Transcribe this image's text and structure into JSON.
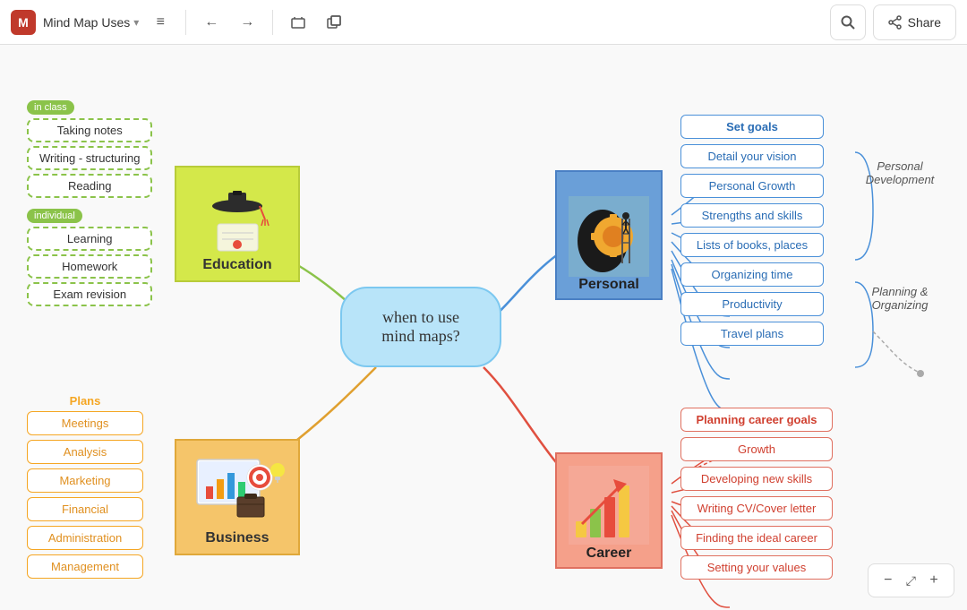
{
  "topbar": {
    "logo": "M",
    "title": "Mind Map Uses",
    "chevron": "▾",
    "menu_icon": "≡",
    "undo_label": "undo",
    "redo_label": "redo",
    "frame_label": "frame",
    "clone_label": "clone",
    "search_label": "search",
    "share_label": "Share"
  },
  "center_node": {
    "text": "when to use\nmind maps?"
  },
  "education": {
    "node_label": "Education",
    "badge_in_class": "in class",
    "badge_individual": "individual",
    "in_class_items": [
      "Taking notes",
      "Writing - structuring",
      "Reading"
    ],
    "individual_items": [
      "Learning",
      "Homework",
      "Exam revision"
    ]
  },
  "personal": {
    "node_label": "Personal",
    "items": [
      "Set goals",
      "Detail your vision",
      "Personal Growth",
      "Strengths and skills",
      "Lists of books, places",
      "Organizing time",
      "Productivity",
      "Travel plans"
    ],
    "personal_dev_label": "Personal\nDevelopment",
    "planning_label": "Planning &\nOrganizing"
  },
  "business": {
    "node_label": "Business",
    "header": "Plans",
    "items": [
      "Meetings",
      "Analysis",
      "Marketing",
      "Financial",
      "Administration",
      "Management"
    ]
  },
  "career": {
    "node_label": "Career",
    "items": [
      "Planning career goals",
      "Growth",
      "Developing new skills",
      "Writing CV/Cover letter",
      "Finding the ideal career",
      "Setting  your values"
    ]
  },
  "zoom": {
    "minus": "−",
    "fit": "⤢",
    "plus": "+"
  }
}
